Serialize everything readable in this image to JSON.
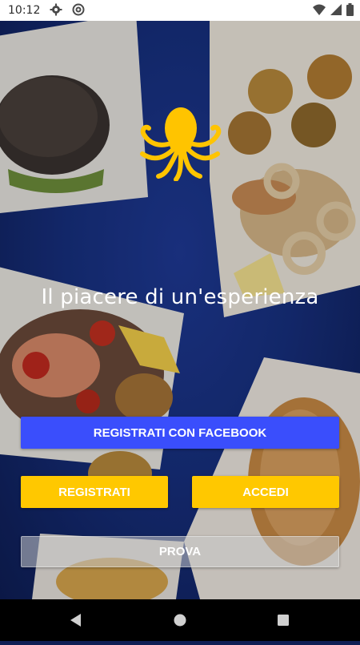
{
  "status_bar": {
    "time": "10:12",
    "icons": [
      "gear-icon",
      "at-sign-icon",
      "wifi-icon",
      "signal-icon",
      "battery-icon"
    ]
  },
  "hero": {
    "tagline": "Il piacere di un'esperienza",
    "logo": "octopus-logo"
  },
  "buttons": {
    "facebook": "REGISTRATI CON FACEBOOK",
    "register": "REGISTRATI",
    "login": "ACCEDI",
    "try": "PROVA"
  },
  "nav_bar": {
    "icons": [
      "back-icon",
      "home-icon",
      "recents-icon"
    ]
  },
  "colors": {
    "facebook_blue": "#3a4efc",
    "accent_yellow": "#ffc800",
    "background_blue": "#173080"
  }
}
